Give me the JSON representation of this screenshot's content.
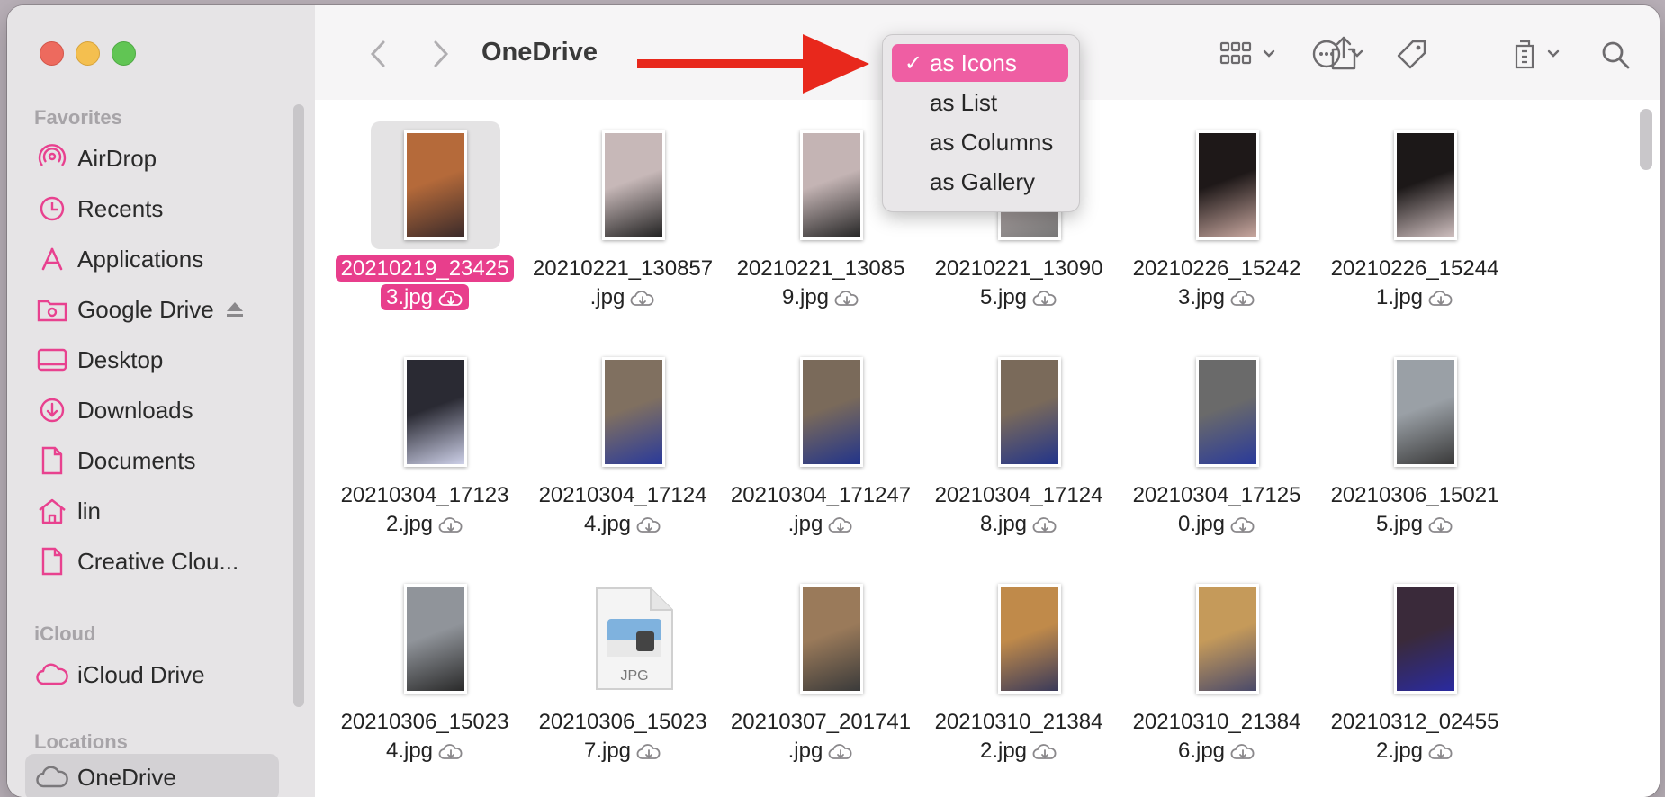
{
  "window": {
    "title": "OneDrive"
  },
  "sidebar": {
    "favorites_header": "Favorites",
    "icloud_header": "iCloud",
    "locations_header": "Locations",
    "favorites": [
      {
        "label": "AirDrop",
        "icon": "airdrop-icon"
      },
      {
        "label": "Recents",
        "icon": "clock-icon"
      },
      {
        "label": "Applications",
        "icon": "applications-icon"
      },
      {
        "label": "Google Drive",
        "icon": "folder-icon"
      },
      {
        "label": "Desktop",
        "icon": "desktop-icon"
      },
      {
        "label": "Downloads",
        "icon": "download-icon"
      },
      {
        "label": "Documents",
        "icon": "document-icon"
      },
      {
        "label": "lin",
        "icon": "home-icon"
      },
      {
        "label": "Creative Clou...",
        "icon": "document-icon"
      }
    ],
    "icloud": [
      {
        "label": "iCloud Drive",
        "icon": "cloud-icon"
      }
    ],
    "locations": [
      {
        "label": "OneDrive",
        "icon": "cloud-icon"
      }
    ]
  },
  "view_menu": {
    "items": [
      {
        "label": "as Icons",
        "checked": true,
        "check": "✓"
      },
      {
        "label": "as List",
        "checked": false,
        "check": ""
      },
      {
        "label": "as Columns",
        "checked": false,
        "check": ""
      },
      {
        "label": "as Gallery",
        "checked": false,
        "check": ""
      }
    ]
  },
  "files": [
    {
      "line1": "20210219_23425",
      "line2": "3.jpg",
      "selected": true,
      "thumb": [
        "#b56a3a",
        "#3a2a2a"
      ]
    },
    {
      "line1": "20210221_130857",
      "line2": ".jpg",
      "selected": false,
      "thumb": [
        "#c7b8b8",
        "#222222"
      ]
    },
    {
      "line1": "20210221_13085",
      "line2": "9.jpg",
      "selected": false,
      "thumb": [
        "#c4b4b4",
        "#262626"
      ]
    },
    {
      "line1": "20210221_13090",
      "line2": "5.jpg",
      "selected": false,
      "thumb": [
        "#bdb0b0",
        "#777777"
      ]
    },
    {
      "line1": "20210226_15242",
      "line2": "3.jpg",
      "selected": false,
      "thumb": [
        "#1e1818",
        "#c9a8a0"
      ]
    },
    {
      "line1": "20210226_15244",
      "line2": "1.jpg",
      "selected": false,
      "thumb": [
        "#1c1818",
        "#d0c0c0"
      ]
    },
    {
      "line1": "20210304_17123",
      "line2": "2.jpg",
      "selected": false,
      "thumb": [
        "#2a2a33",
        "#cdd0e8"
      ]
    },
    {
      "line1": "20210304_17124",
      "line2": "4.jpg",
      "selected": false,
      "thumb": [
        "#807060",
        "#2a3a9a"
      ]
    },
    {
      "line1": "20210304_171247",
      "line2": ".jpg",
      "selected": false,
      "thumb": [
        "#7a6a5a",
        "#22348a"
      ]
    },
    {
      "line1": "20210304_17124",
      "line2": "8.jpg",
      "selected": false,
      "thumb": [
        "#7a6a5a",
        "#22348a"
      ]
    },
    {
      "line1": "20210304_17125",
      "line2": "0.jpg",
      "selected": false,
      "thumb": [
        "#6a6a6a",
        "#2a3a9a"
      ]
    },
    {
      "line1": "20210306_15021",
      "line2": "5.jpg",
      "selected": false,
      "thumb": [
        "#9aa0a6",
        "#3a3a3a"
      ]
    },
    {
      "line1": "20210306_15023",
      "line2": "4.jpg",
      "selected": false,
      "thumb": [
        "#90949a",
        "#2a2a2a"
      ]
    },
    {
      "line1": "20210306_15023",
      "line2": "7.jpg",
      "selected": false,
      "generic": true,
      "badge": "JPG"
    },
    {
      "line1": "20210307_201741",
      "line2": ".jpg",
      "selected": false,
      "thumb": [
        "#9a7a5a",
        "#3a3a3a"
      ]
    },
    {
      "line1": "20210310_21384",
      "line2": "2.jpg",
      "selected": false,
      "thumb": [
        "#c08a4a",
        "#3a3a5a"
      ]
    },
    {
      "line1": "20210310_21384",
      "line2": "6.jpg",
      "selected": false,
      "thumb": [
        "#c59a5a",
        "#4a4a6a"
      ]
    },
    {
      "line1": "20210312_02455",
      "line2": "2.jpg",
      "selected": false,
      "thumb": [
        "#3a2a3a",
        "#2a2aa0"
      ]
    }
  ],
  "colors": {
    "accent": "#e83e8c",
    "arrow": "#e8281c"
  }
}
